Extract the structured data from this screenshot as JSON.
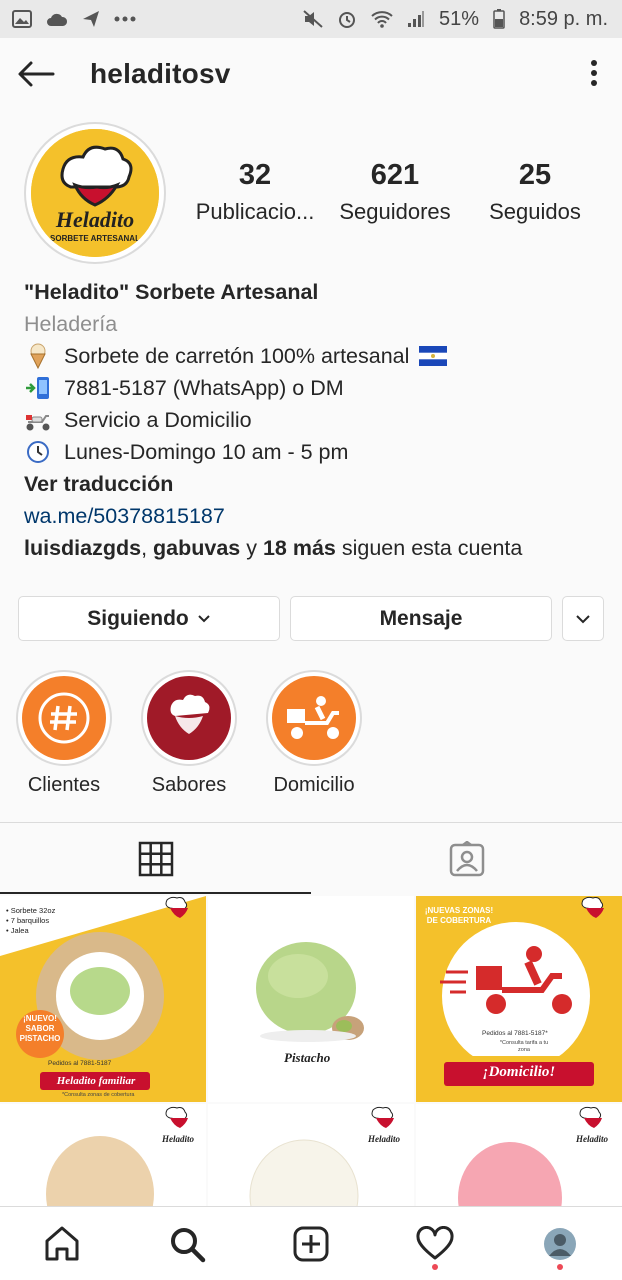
{
  "status_bar": {
    "battery": "51%",
    "time": "8:59 p. m.",
    "left_icons": [
      "image-icon",
      "cloud-icon",
      "send-icon",
      "more-dots-icon"
    ],
    "right_icons": [
      "mute-icon",
      "alarm-icon",
      "wifi-icon",
      "signal-icon",
      "battery-icon"
    ]
  },
  "header": {
    "username": "heladitosv"
  },
  "profile": {
    "avatar_brand": "Heladito",
    "avatar_sub": "SORBETE ARTESANAL",
    "stats": [
      {
        "value": "32",
        "label": "Publicacio..."
      },
      {
        "value": "621",
        "label": "Seguidores"
      },
      {
        "value": "25",
        "label": "Seguidos"
      }
    ]
  },
  "bio": {
    "name": "\"Heladito\" Sorbete Artesanal",
    "category": "Heladería",
    "lines": [
      {
        "icon": "ice-cream-icon",
        "text": "Sorbete de carretón 100% artesanal"
      },
      {
        "icon": "phone-icon",
        "text": "7881-5187 (WhatsApp) o DM"
      },
      {
        "icon": "scooter-icon",
        "text": "Servicio a Domicilio"
      },
      {
        "icon": "clock-icon",
        "text": "Lunes-Domingo 10 am  -  5 pm"
      }
    ],
    "translate": "Ver traducción",
    "link": "wa.me/50378815187",
    "followers_part1": "luisdiazgds",
    "followers_sep1": ", ",
    "followers_part2": "gabuvas",
    "followers_sep2": " y ",
    "followers_part3": "18 más",
    "followers_tail": " siguen esta cuenta"
  },
  "actions": {
    "following_label": "Siguiendo",
    "message_label": "Mensaje"
  },
  "highlights": [
    {
      "label": "Clientes",
      "color": "#f47f2a"
    },
    {
      "label": "Sabores",
      "color": "#a01a28"
    },
    {
      "label": "Domicilio",
      "color": "#f47f2a"
    }
  ],
  "posts": {
    "p1": {
      "items": [
        "• Sorbete 32oz",
        "• 7 barquillos",
        "• Jalea"
      ],
      "badge": "¡NUEVO! SABOR PISTACHO",
      "order": "Pedidos al  7881-5187",
      "title": "Heladito familiar",
      "note": "*Consulta zonas de cobertura"
    },
    "p2": {
      "caption": "Pistacho"
    },
    "p3": {
      "header": "¡NUEVAS ZONAS! DE COBERTURA",
      "order": "Pedidos al  7881-5187*",
      "note": "*Consulta tarifa a tu zona",
      "title": "¡Domicilio!"
    }
  },
  "colors": {
    "brand_yellow": "#f4c12b",
    "brand_red": "#c8102e",
    "link": "#00376b",
    "notification": "#ed4956"
  }
}
